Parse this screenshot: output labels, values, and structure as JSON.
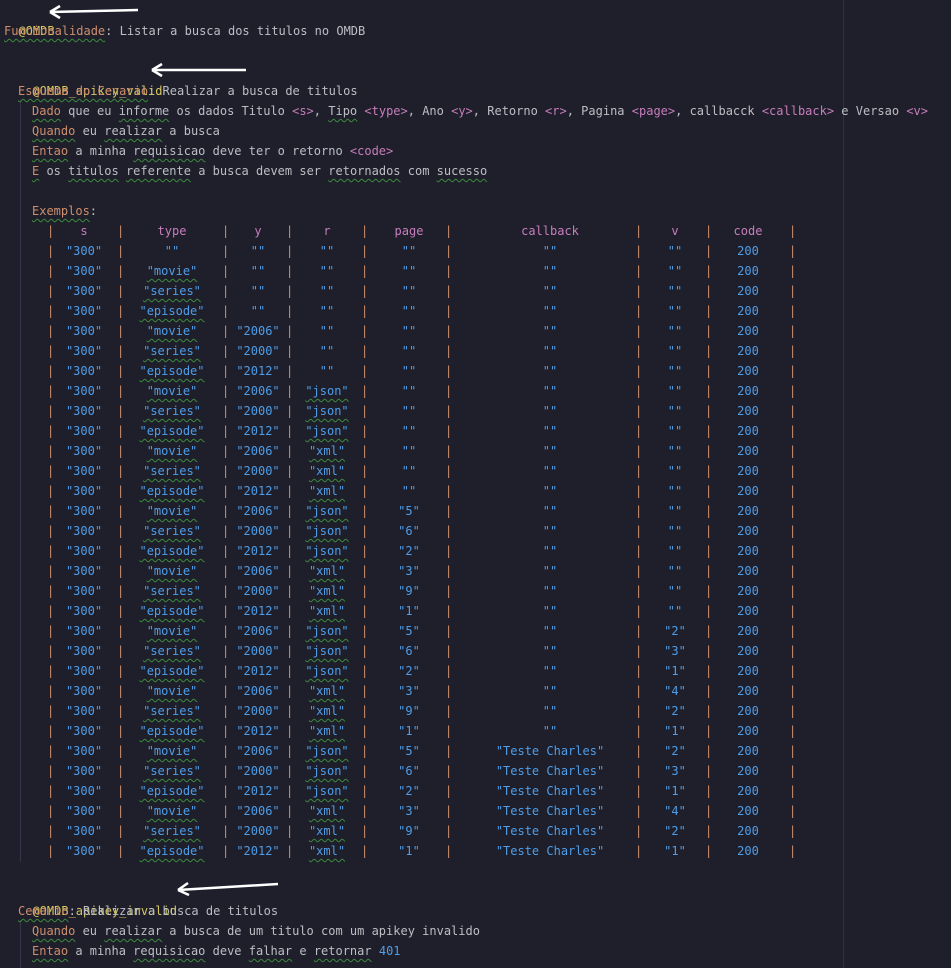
{
  "feature": {
    "tag": "@OMDB",
    "keyword": "Funcionalidade",
    "title": "Listar a busca dos titulos no OMDB"
  },
  "scenario_valid": {
    "tag": "@OMDB_apikey_valid",
    "keyword": "Esquema do Cenario",
    "title": "Realizar a busca de titulos",
    "steps": [
      {
        "kw": "Dado",
        "parts": [
          {
            "t": " que eu "
          },
          {
            "t": "informe",
            "sq": true
          },
          {
            "t": " os dados Titulo "
          },
          {
            "t": "<s>",
            "ph": true
          },
          {
            "t": ", "
          },
          {
            "t": "Tipo",
            "sq": true
          },
          {
            "t": " "
          },
          {
            "t": "<type>",
            "ph": true
          },
          {
            "t": ", Ano "
          },
          {
            "t": "<y>",
            "ph": true
          },
          {
            "t": ", Retorno "
          },
          {
            "t": "<r>",
            "ph": true
          },
          {
            "t": ", Pagina "
          },
          {
            "t": "<page>",
            "ph": true
          },
          {
            "t": ", callbacck "
          },
          {
            "t": "<callback>",
            "ph": true
          },
          {
            "t": " e Versao "
          },
          {
            "t": "<v>",
            "ph": true
          }
        ]
      },
      {
        "kw": "Quando",
        "parts": [
          {
            "t": " eu "
          },
          {
            "t": "realizar",
            "sq": true
          },
          {
            "t": " a busca"
          }
        ]
      },
      {
        "kw": "Entao",
        "parts": [
          {
            "t": " a minha "
          },
          {
            "t": "requisicao",
            "sq": true
          },
          {
            "t": " deve ter o retorno "
          },
          {
            "t": "<code>",
            "ph": true
          }
        ]
      },
      {
        "kw": "E",
        "parts": [
          {
            "t": " os "
          },
          {
            "t": "titulos",
            "sq": true
          },
          {
            "t": " "
          },
          {
            "t": "referente",
            "sq": true
          },
          {
            "t": " a busca devem ser "
          },
          {
            "t": "retornados",
            "sq": true
          },
          {
            "t": " com "
          },
          {
            "t": "sucesso",
            "sq": true
          }
        ]
      }
    ],
    "examples_keyword": "Exemplos",
    "examples": {
      "headers": [
        "s",
        "type",
        "y",
        "r",
        "page",
        "callback",
        "v",
        "code"
      ],
      "rows": [
        [
          "\"300\"",
          "\"\"",
          "\"\"",
          "\"\"",
          "\"\"",
          "\"\"",
          "\"\"",
          "200"
        ],
        [
          "\"300\"",
          "\"movie\"",
          "\"\"",
          "\"\"",
          "\"\"",
          "\"\"",
          "\"\"",
          "200"
        ],
        [
          "\"300\"",
          "\"series\"",
          "\"\"",
          "\"\"",
          "\"\"",
          "\"\"",
          "\"\"",
          "200"
        ],
        [
          "\"300\"",
          "\"episode\"",
          "\"\"",
          "\"\"",
          "\"\"",
          "\"\"",
          "\"\"",
          "200"
        ],
        [
          "\"300\"",
          "\"movie\"",
          "\"2006\"",
          "\"\"",
          "\"\"",
          "\"\"",
          "\"\"",
          "200"
        ],
        [
          "\"300\"",
          "\"series\"",
          "\"2000\"",
          "\"\"",
          "\"\"",
          "\"\"",
          "\"\"",
          "200"
        ],
        [
          "\"300\"",
          "\"episode\"",
          "\"2012\"",
          "\"\"",
          "\"\"",
          "\"\"",
          "\"\"",
          "200"
        ],
        [
          "\"300\"",
          "\"movie\"",
          "\"2006\"",
          "\"json\"",
          "\"\"",
          "\"\"",
          "\"\"",
          "200"
        ],
        [
          "\"300\"",
          "\"series\"",
          "\"2000\"",
          "\"json\"",
          "\"\"",
          "\"\"",
          "\"\"",
          "200"
        ],
        [
          "\"300\"",
          "\"episode\"",
          "\"2012\"",
          "\"json\"",
          "\"\"",
          "\"\"",
          "\"\"",
          "200"
        ],
        [
          "\"300\"",
          "\"movie\"",
          "\"2006\"",
          "\"xml\"",
          "\"\"",
          "\"\"",
          "\"\"",
          "200"
        ],
        [
          "\"300\"",
          "\"series\"",
          "\"2000\"",
          "\"xml\"",
          "\"\"",
          "\"\"",
          "\"\"",
          "200"
        ],
        [
          "\"300\"",
          "\"episode\"",
          "\"2012\"",
          "\"xml\"",
          "\"\"",
          "\"\"",
          "\"\"",
          "200"
        ],
        [
          "\"300\"",
          "\"movie\"",
          "\"2006\"",
          "\"json\"",
          "\"5\"",
          "\"\"",
          "\"\"",
          "200"
        ],
        [
          "\"300\"",
          "\"series\"",
          "\"2000\"",
          "\"json\"",
          "\"6\"",
          "\"\"",
          "\"\"",
          "200"
        ],
        [
          "\"300\"",
          "\"episode\"",
          "\"2012\"",
          "\"json\"",
          "\"2\"",
          "\"\"",
          "\"\"",
          "200"
        ],
        [
          "\"300\"",
          "\"movie\"",
          "\"2006\"",
          "\"xml\"",
          "\"3\"",
          "\"\"",
          "\"\"",
          "200"
        ],
        [
          "\"300\"",
          "\"series\"",
          "\"2000\"",
          "\"xml\"",
          "\"9\"",
          "\"\"",
          "\"\"",
          "200"
        ],
        [
          "\"300\"",
          "\"episode\"",
          "\"2012\"",
          "\"xml\"",
          "\"1\"",
          "\"\"",
          "\"\"",
          "200"
        ],
        [
          "\"300\"",
          "\"movie\"",
          "\"2006\"",
          "\"json\"",
          "\"5\"",
          "\"\"",
          "\"2\"",
          "200"
        ],
        [
          "\"300\"",
          "\"series\"",
          "\"2000\"",
          "\"json\"",
          "\"6\"",
          "\"\"",
          "\"3\"",
          "200"
        ],
        [
          "\"300\"",
          "\"episode\"",
          "\"2012\"",
          "\"json\"",
          "\"2\"",
          "\"\"",
          "\"1\"",
          "200"
        ],
        [
          "\"300\"",
          "\"movie\"",
          "\"2006\"",
          "\"xml\"",
          "\"3\"",
          "\"\"",
          "\"4\"",
          "200"
        ],
        [
          "\"300\"",
          "\"series\"",
          "\"2000\"",
          "\"xml\"",
          "\"9\"",
          "\"\"",
          "\"2\"",
          "200"
        ],
        [
          "\"300\"",
          "\"episode\"",
          "\"2012\"",
          "\"xml\"",
          "\"1\"",
          "\"\"",
          "\"1\"",
          "200"
        ],
        [
          "\"300\"",
          "\"movie\"",
          "\"2006\"",
          "\"json\"",
          "\"5\"",
          "\"Teste Charles\"",
          "\"2\"",
          "200"
        ],
        [
          "\"300\"",
          "\"series\"",
          "\"2000\"",
          "\"json\"",
          "\"6\"",
          "\"Teste Charles\"",
          "\"3\"",
          "200"
        ],
        [
          "\"300\"",
          "\"episode\"",
          "\"2012\"",
          "\"json\"",
          "\"2\"",
          "\"Teste Charles\"",
          "\"1\"",
          "200"
        ],
        [
          "\"300\"",
          "\"movie\"",
          "\"2006\"",
          "\"xml\"",
          "\"3\"",
          "\"Teste Charles\"",
          "\"4\"",
          "200"
        ],
        [
          "\"300\"",
          "\"series\"",
          "\"2000\"",
          "\"xml\"",
          "\"9\"",
          "\"Teste Charles\"",
          "\"2\"",
          "200"
        ],
        [
          "\"300\"",
          "\"episode\"",
          "\"2012\"",
          "\"xml\"",
          "\"1\"",
          "\"Teste Charles\"",
          "\"1\"",
          "200"
        ]
      ]
    }
  },
  "scenario_invalid": {
    "tag": "@OMDB_apikey_invalid",
    "keyword": "Cenario",
    "title": "Realizar a busca de titulos",
    "steps": [
      {
        "kw": "Quando",
        "parts": [
          {
            "t": " eu "
          },
          {
            "t": "realizar",
            "sq": true
          },
          {
            "t": " a busca de um titulo com um apikey invalido"
          }
        ]
      },
      {
        "kw": "Entao",
        "parts": [
          {
            "t": " a minha "
          },
          {
            "t": "requisicao",
            "sq": true
          },
          {
            "t": " deve "
          },
          {
            "t": "falhar",
            "sq": true
          },
          {
            "t": " e "
          },
          {
            "t": "retornar",
            "sq": true
          },
          {
            "t": " "
          },
          {
            "t": "401",
            "num": true
          }
        ]
      }
    ]
  },
  "colors": {
    "background": "#1e1f2b",
    "tag": "#d6c85f",
    "keyword": "#cf8e6d",
    "text": "#bcbec4",
    "placeholder": "#c77dbb",
    "value": "#4f9de8",
    "squiggle": "#3c8a3c",
    "annotation_arrow": "#ffffff"
  }
}
